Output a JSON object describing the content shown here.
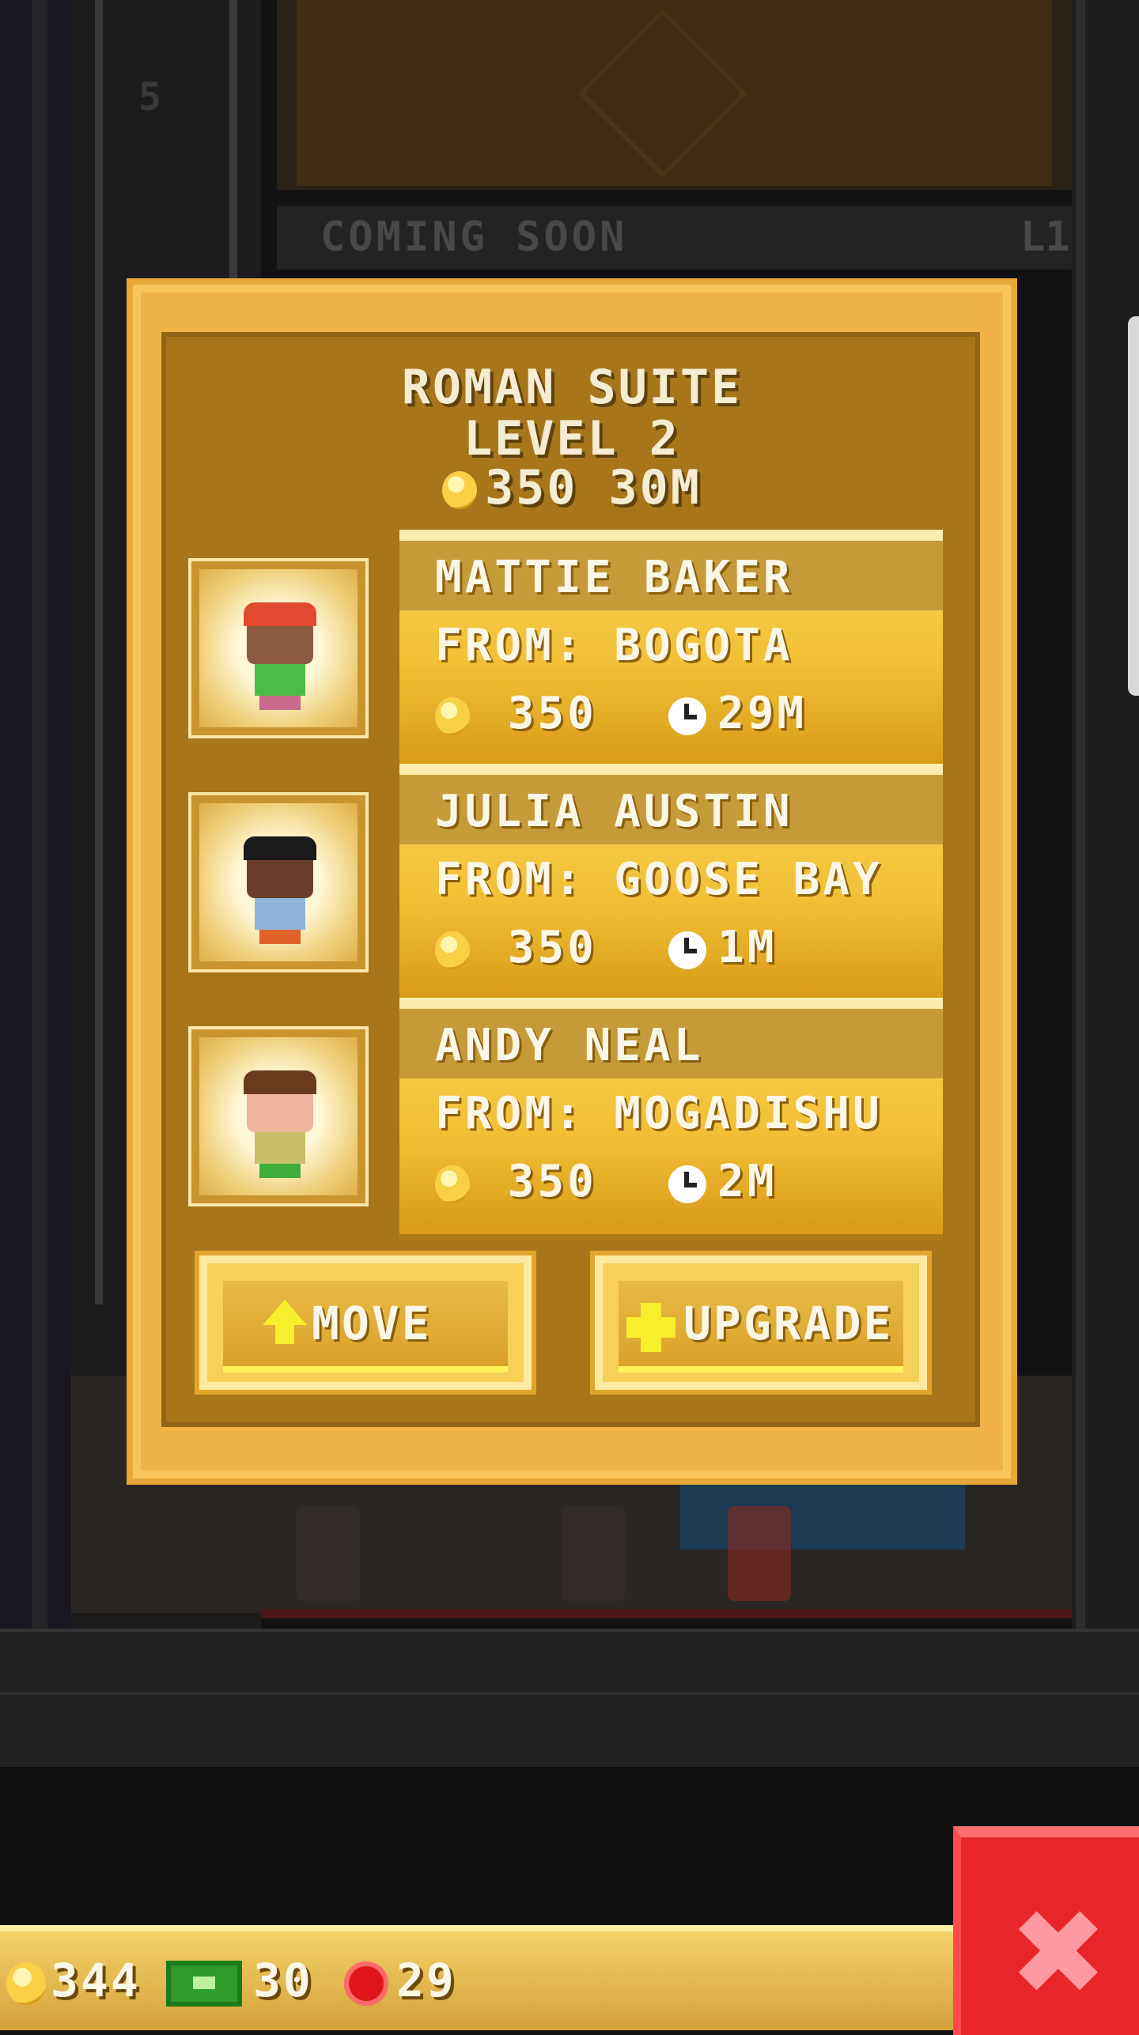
{
  "background": {
    "floor_label": "COMING SOON",
    "floor_number": "L1",
    "shaft_number": "5"
  },
  "dialog": {
    "title": "ROMAN SUITE",
    "level": "LEVEL 2",
    "price": "350 30M"
  },
  "residents": [
    {
      "name": "MATTIE BAKER",
      "from": "FROM: BOGOTA",
      "coins": "350",
      "time": "29M",
      "hair_color": "#e24a2f",
      "skin_color": "#8d5a42",
      "shirt_color": "#4bbd45"
    },
    {
      "name": "JULIA AUSTIN",
      "from": "FROM: GOOSE BAY",
      "coins": "350",
      "time": "1M",
      "hair_color": "#1a1a1a",
      "skin_color": "#6b3f2c",
      "shirt_color": "#8fb5dc"
    },
    {
      "name": "ANDY NEAL",
      "from": "FROM: MOGADISHU",
      "coins": "350",
      "time": "2M",
      "hair_color": "#6a3a1c",
      "skin_color": "#efb59f",
      "shirt_color": "#c8c06a"
    }
  ],
  "buttons": {
    "move": "MOVE",
    "upgrade": "UPGRADE"
  },
  "hud": {
    "coins": "344",
    "bux": "30",
    "chips": "29"
  },
  "icons": {
    "coin": "coin-icon",
    "clock": "clock-icon",
    "bux": "bux-icon",
    "chip": "chip-icon",
    "close": "close-icon"
  }
}
